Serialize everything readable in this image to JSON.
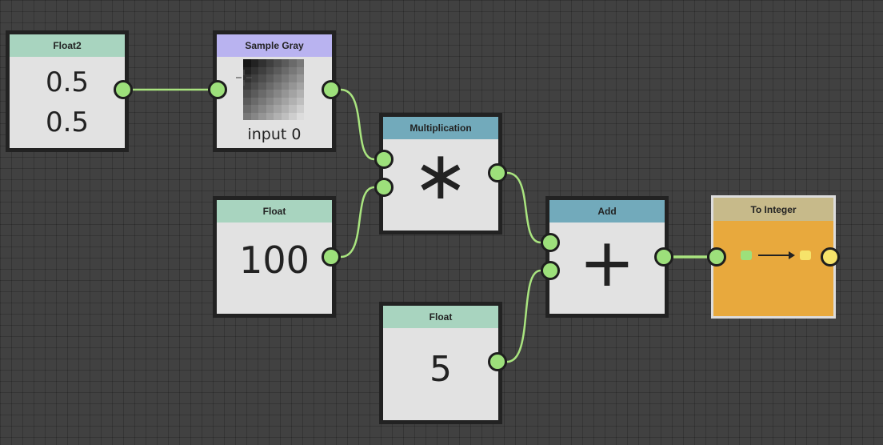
{
  "canvas": {
    "background": "#414141",
    "wire_color": "#a9e47f",
    "port_color": "#9de07b",
    "port_output_int_color": "#f6e36a"
  },
  "nodes": {
    "float2": {
      "title": "Float2",
      "header_color": "#a8d4bf",
      "values": [
        "0.5",
        "0.5"
      ]
    },
    "sample_gray": {
      "title": "Sample Gray",
      "header_color": "#b9b3f0",
      "caption": "input 0"
    },
    "multiplication": {
      "title": "Multiplication",
      "header_color": "#72aabb",
      "symbol": "∗"
    },
    "float_a": {
      "title": "Float",
      "header_color": "#a8d4bf",
      "value": "100"
    },
    "add": {
      "title": "Add",
      "header_color": "#72aabb",
      "symbol": "+"
    },
    "float_b": {
      "title": "Float",
      "header_color": "#a8d4bf",
      "value": "5"
    },
    "to_integer": {
      "title": "To Integer",
      "header_color": "#c7ba8a",
      "body_color": "#e8a93d"
    }
  }
}
